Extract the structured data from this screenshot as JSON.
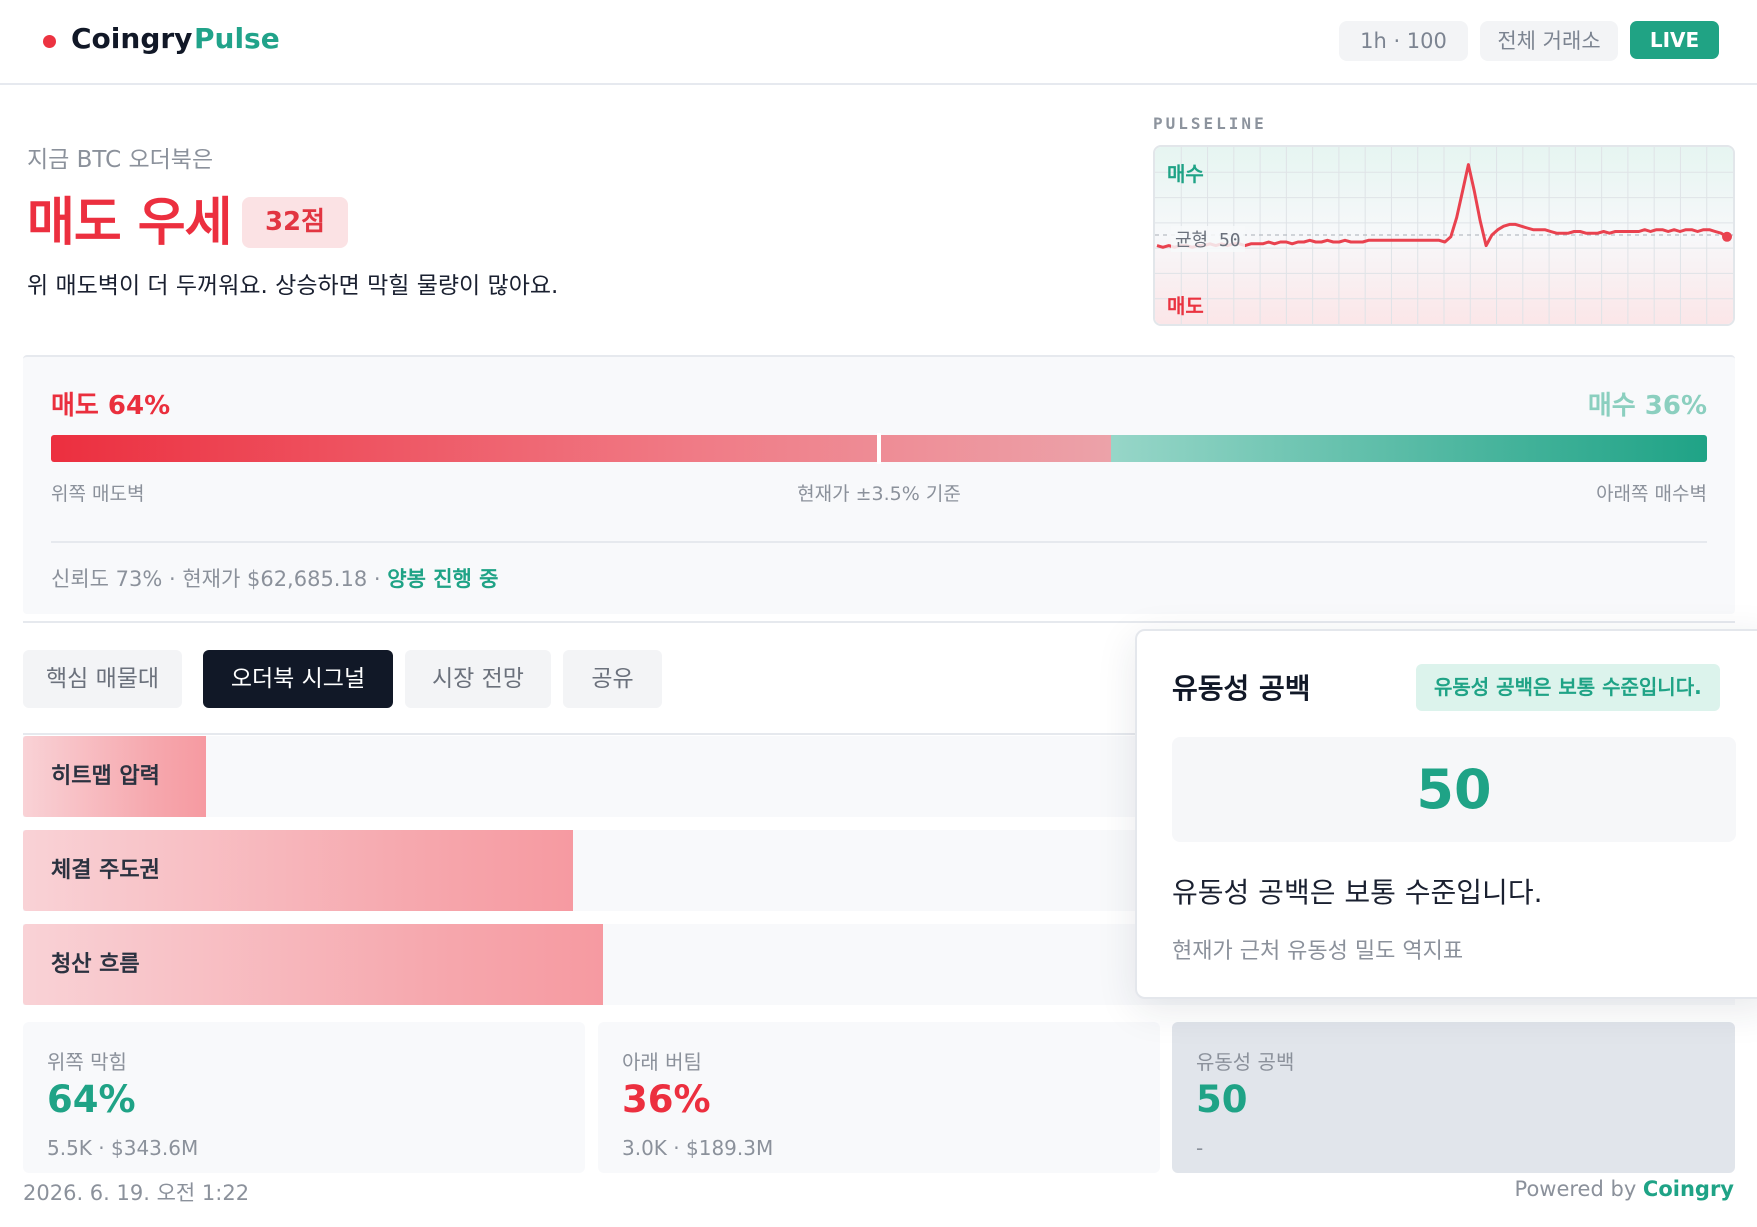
{
  "brand": {
    "name": "Coingry",
    "product": "Pulse",
    "accent": "#21a38a",
    "dot_color": "#ec3341"
  },
  "header": {
    "range_chip": "1h · 100",
    "exchange_chip": "전체 거래소",
    "live_chip": "LIVE"
  },
  "hero": {
    "kicker": "지금 BTC 오더북은",
    "title": "매도 우세",
    "score_badge": "32점",
    "description": "위 매도벽이 더 두꺼워요. 상승하면 막힐 물량이 많아요."
  },
  "pulseline": {
    "label": "PULSELINE",
    "buy_label": "매수",
    "sell_label": "매도",
    "mid_label": "균형 50",
    "line_color": "#e9424f",
    "values": [
      44,
      43,
      44,
      43,
      44,
      44,
      43,
      44,
      44,
      45,
      44,
      45,
      44,
      45,
      45,
      44,
      45,
      45,
      45,
      46,
      45,
      46,
      46,
      45,
      46,
      46,
      47,
      46,
      46,
      47,
      46,
      46,
      47,
      46,
      46,
      46,
      47,
      47,
      47,
      47,
      47,
      47,
      47,
      47,
      47,
      47,
      47,
      47,
      47,
      46,
      49,
      60,
      75,
      90,
      75,
      58,
      44,
      50,
      53,
      55,
      56,
      56,
      55,
      54,
      53,
      53,
      53,
      52,
      51,
      51,
      51,
      52,
      52,
      51,
      51,
      51,
      52,
      51,
      52,
      52,
      52,
      52,
      52,
      53,
      52,
      53,
      53,
      52,
      53,
      52,
      53,
      53,
      52,
      53,
      53,
      52,
      51,
      49
    ]
  },
  "balance": {
    "sell_label": "매도 64%",
    "buy_label": "매수 36%",
    "sell_percent": 64,
    "marker_percent": 50,
    "left_caption": "위쪽 매도벽",
    "center_caption": "현재가 ±3.5% 기준",
    "right_caption": "아래쪽 매수벽",
    "footer_text": "신뢰도 73% · 현재가 $62,685.18 · ",
    "footer_status": "양봉 진행 중"
  },
  "tabs": [
    "핵심 매물대",
    "오더북 시그널",
    "시장 전망",
    "공유"
  ],
  "active_tab": 1,
  "signals": [
    {
      "label": "히트맵 압력",
      "level": 0.107
    },
    {
      "label": "체결 주도권",
      "level": 0.321
    },
    {
      "label": "청산 흐름",
      "level": 0.339
    }
  ],
  "cards": [
    {
      "label": "위쪽 막힘",
      "value": "64%",
      "sub": "5.5K · $343.6M"
    },
    {
      "label": "아래 버팀",
      "value": "36%",
      "sub": "3.0K · $189.3M"
    },
    {
      "label": "유동성 공백",
      "value": "50",
      "sub": "-"
    }
  ],
  "popover": {
    "title": "유동성 공백",
    "badge": "유동성 공백은 보통 수준입니다.",
    "score": "50",
    "text": "유동성 공백은 보통 수준입니다.",
    "note": "현재가 근처 유동성 밀도 역지표"
  },
  "footer": {
    "date": "2026. 6. 19. 오전 1:22",
    "powered_prefix": "Powered by ",
    "powered_brand": "Coingry"
  }
}
